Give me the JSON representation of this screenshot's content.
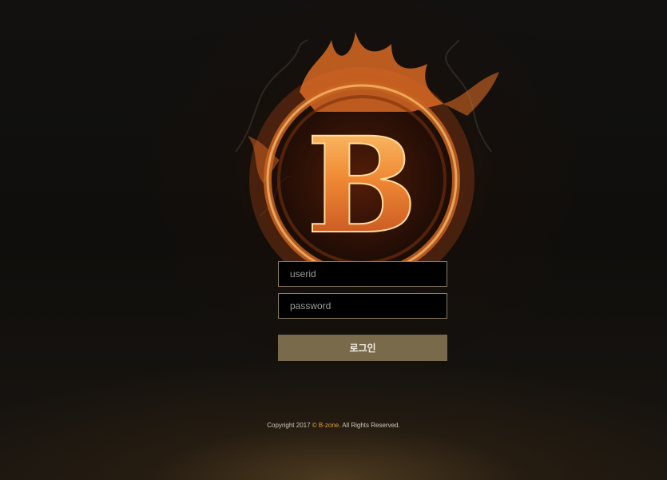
{
  "logo": {
    "letter": "B"
  },
  "login": {
    "userid_placeholder": "userid",
    "password_placeholder": "password",
    "submit_label": "로그인"
  },
  "footer": {
    "copyright_prefix": "Copyright 2017 ",
    "brand": "© B-zone",
    "copyright_suffix": ". All Rights Reserved."
  },
  "colors": {
    "button_bg": "#7a6a4c",
    "input_border": "#8a7d64",
    "brand_accent": "#e0a23a",
    "flame": "#e8772a"
  },
  "icons": [
    "flaming-ring-logo-icon"
  ]
}
